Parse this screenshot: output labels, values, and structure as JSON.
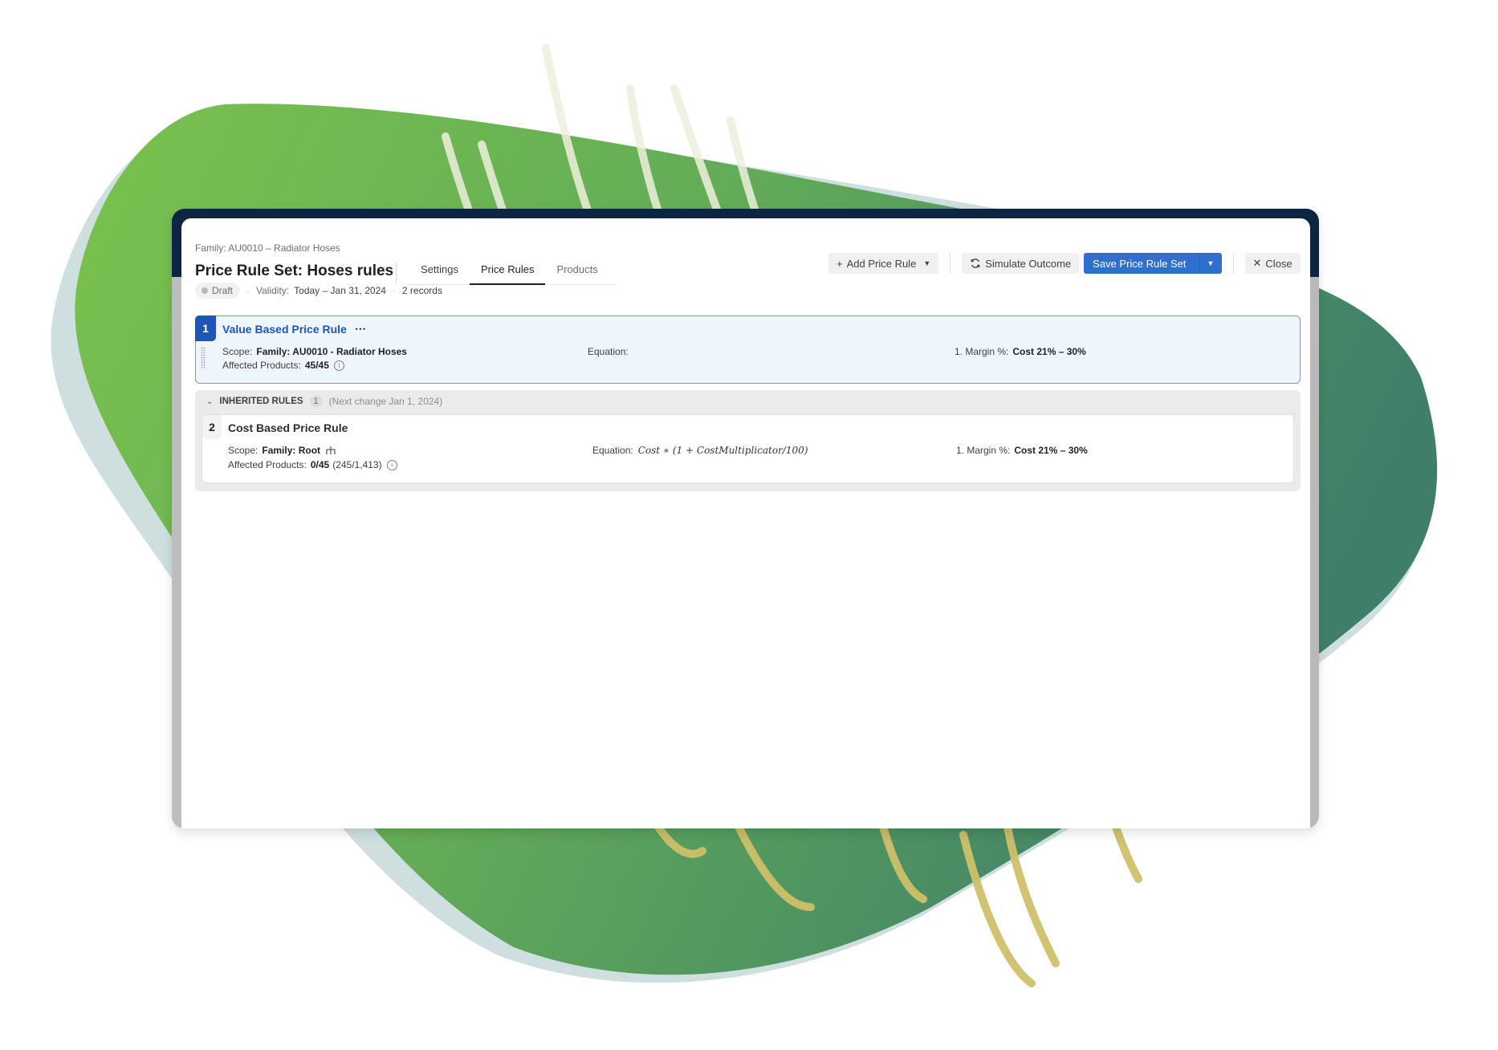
{
  "header": {
    "breadcrumb": "Family: AU0010 – Radiator Hoses",
    "title": "Price Rule Set: Hoses rules",
    "tabs": [
      {
        "label": "Settings",
        "active": false
      },
      {
        "label": "Price Rules",
        "active": true
      },
      {
        "label": "Products",
        "active": false
      }
    ],
    "status": {
      "badge": "Draft",
      "validity_label": "Validity:",
      "validity_value": "Today – Jan 31, 2024",
      "records": "2 records"
    }
  },
  "toolbar": {
    "add_price_rule": "Add Price Rule",
    "simulate_outcome": "Simulate Outcome",
    "save_price_rule_set": "Save Price Rule Set",
    "close": "Close"
  },
  "rules": [
    {
      "number": "1",
      "title": "Value Based Price Rule",
      "more_icon": "⋯",
      "scope_label": "Scope:",
      "scope_value": "Family: AU0010 - Radiator Hoses",
      "affected_label": "Affected Products:",
      "affected_value": "45/45",
      "equation_label": "Equation:",
      "equation_value": "",
      "margin_label": "1. Margin %:",
      "margin_value": "Cost 21% – 30%"
    }
  ],
  "inherited": {
    "title": "INHERITED RULES",
    "count": "1",
    "note": "(Next change Jan 1, 2024)",
    "rules": [
      {
        "number": "2",
        "title": "Cost Based Price Rule",
        "scope_label": "Scope:",
        "scope_value": "Family: Root",
        "affected_label": "Affected Products:",
        "affected_value": "0/45",
        "affected_extra": "(245/1,413)",
        "equation_label": "Equation:",
        "equation_value": "Cost ∗ (1 + CostMultiplicator/100)",
        "margin_label": "1. Margin %:",
        "margin_value": "Cost 21% – 30%"
      }
    ]
  },
  "colors": {
    "primary": "#2f6fcd",
    "accent_blue": "#1f56b5",
    "frame_navy": "#0c2541",
    "blob_green_light": "#7ac24d",
    "blob_green_dark": "#3f7f6a",
    "scribble_gold": "#cfc06a"
  }
}
